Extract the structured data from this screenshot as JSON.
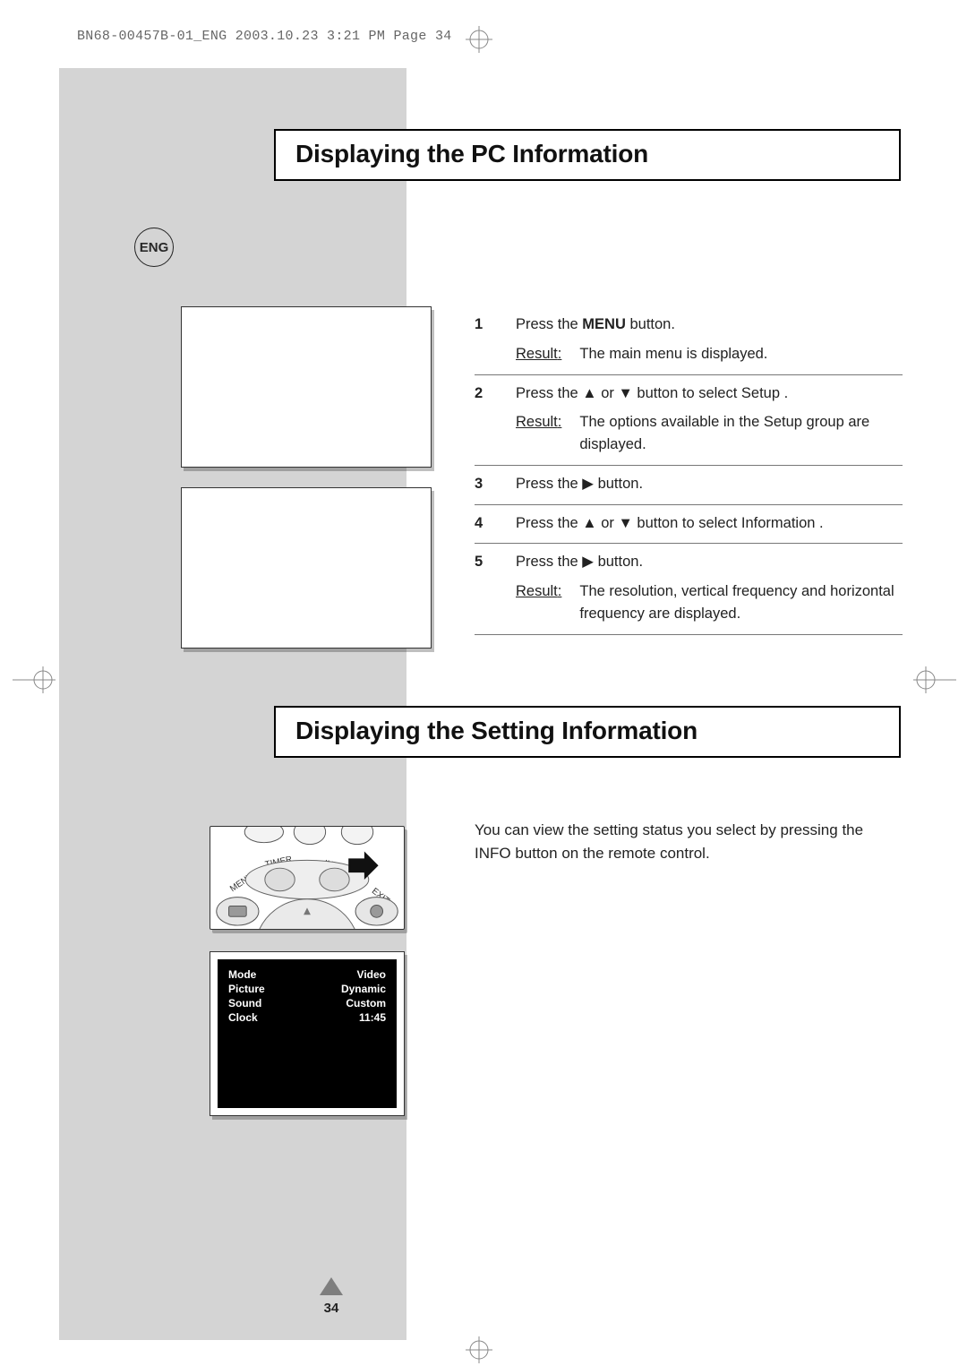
{
  "imprint": "BN68-00457B-01_ENG  2003.10.23  3:21 PM  Page 34",
  "lang_badge": "ENG",
  "section1_title": "Displaying the PC Information",
  "section2_title": "Displaying the Setting Information",
  "steps": [
    {
      "num": "1",
      "line": [
        "Press the ",
        "MENU",
        " button."
      ],
      "result_label": "Result",
      "result_text": "The main menu is displayed."
    },
    {
      "num": "2",
      "line_prefix": "Press the ",
      "line_mid": " or ",
      "line_tail": " button to select ",
      "target": "Setup",
      "tail_punct": " .",
      "result_label": "Result",
      "result_text": "The options available in the Setup  group are displayed."
    },
    {
      "num": "3",
      "line_prefix": "Press the ",
      "line_tail": " button."
    },
    {
      "num": "4",
      "line_prefix": "Press the ",
      "line_mid": " or ",
      "line_tail": " button to select ",
      "target": "Information",
      "tail_punct": "     ."
    },
    {
      "num": "5",
      "line_prefix": "Press the ",
      "line_tail": " button.",
      "result_label": "Result",
      "result_text": "The resolution, vertical frequency and horizontal frequency are displayed."
    }
  ],
  "setting_para": "You can view the setting status you select by pressing the  INFO button on the remote control.",
  "remote_labels": {
    "menu": "MENU",
    "timer": "TIMER",
    "info": "INFO",
    "exit": "EXIT"
  },
  "osd": {
    "rows": [
      {
        "k": "Mode",
        "v": "Video"
      },
      {
        "k": "Picture",
        "v": "Dynamic"
      },
      {
        "k": "Sound",
        "v": "Custom"
      },
      {
        "k": "Clock",
        "v": "11:45"
      }
    ]
  },
  "page_number": "34",
  "glyphs": {
    "up": "▲",
    "down": "▼",
    "right": "▶"
  }
}
